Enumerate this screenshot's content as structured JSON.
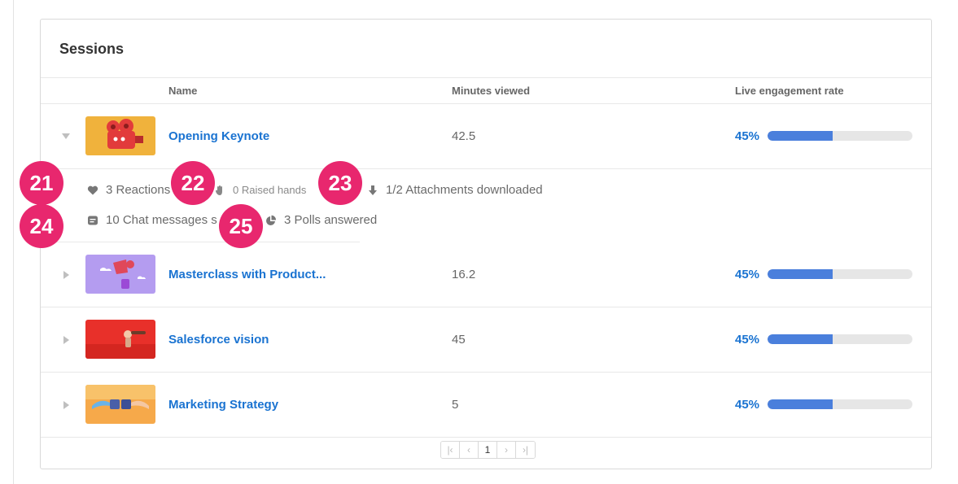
{
  "card": {
    "title": "Sessions"
  },
  "columns": {
    "name": "Name",
    "minutes": "Minutes viewed",
    "engagement": "Live engagement rate"
  },
  "sessions": [
    {
      "name": "Opening Keynote",
      "minutes": "42.5",
      "rate_label": "45%",
      "rate": 0.45,
      "expanded": true
    },
    {
      "name": "Masterclass with Product...",
      "minutes": "16.2",
      "rate_label": "45%",
      "rate": 0.45,
      "expanded": false
    },
    {
      "name": "Salesforce vision",
      "minutes": "45",
      "rate_label": "45%",
      "rate": 0.45,
      "expanded": false
    },
    {
      "name": "Marketing Strategy",
      "minutes": "5",
      "rate_label": "45%",
      "rate": 0.45,
      "expanded": false
    }
  ],
  "details": {
    "reactions": "3 Reactions",
    "raised_hands": "0 Raised hands",
    "attachments": "1/2 Attachments downloaded",
    "chat": "10 Chat messages s",
    "polls": "3 Polls answered"
  },
  "badges": [
    "21",
    "22",
    "23",
    "24",
    "25"
  ],
  "pagination": {
    "current": "1",
    "first": "|‹",
    "prev": "‹",
    "next": "›",
    "last": "›|"
  },
  "colors": {
    "accent": "#1a73d1",
    "bar": "#4a7fdc",
    "badge": "#e8276e"
  },
  "icons": {
    "expand": "caret-down-icon",
    "collapse": "caret-right-icon",
    "reactions": "heart-icon",
    "raised_hands": "hand-icon",
    "attachments": "download-icon",
    "chat": "chat-icon",
    "polls": "pie-chart-icon"
  }
}
